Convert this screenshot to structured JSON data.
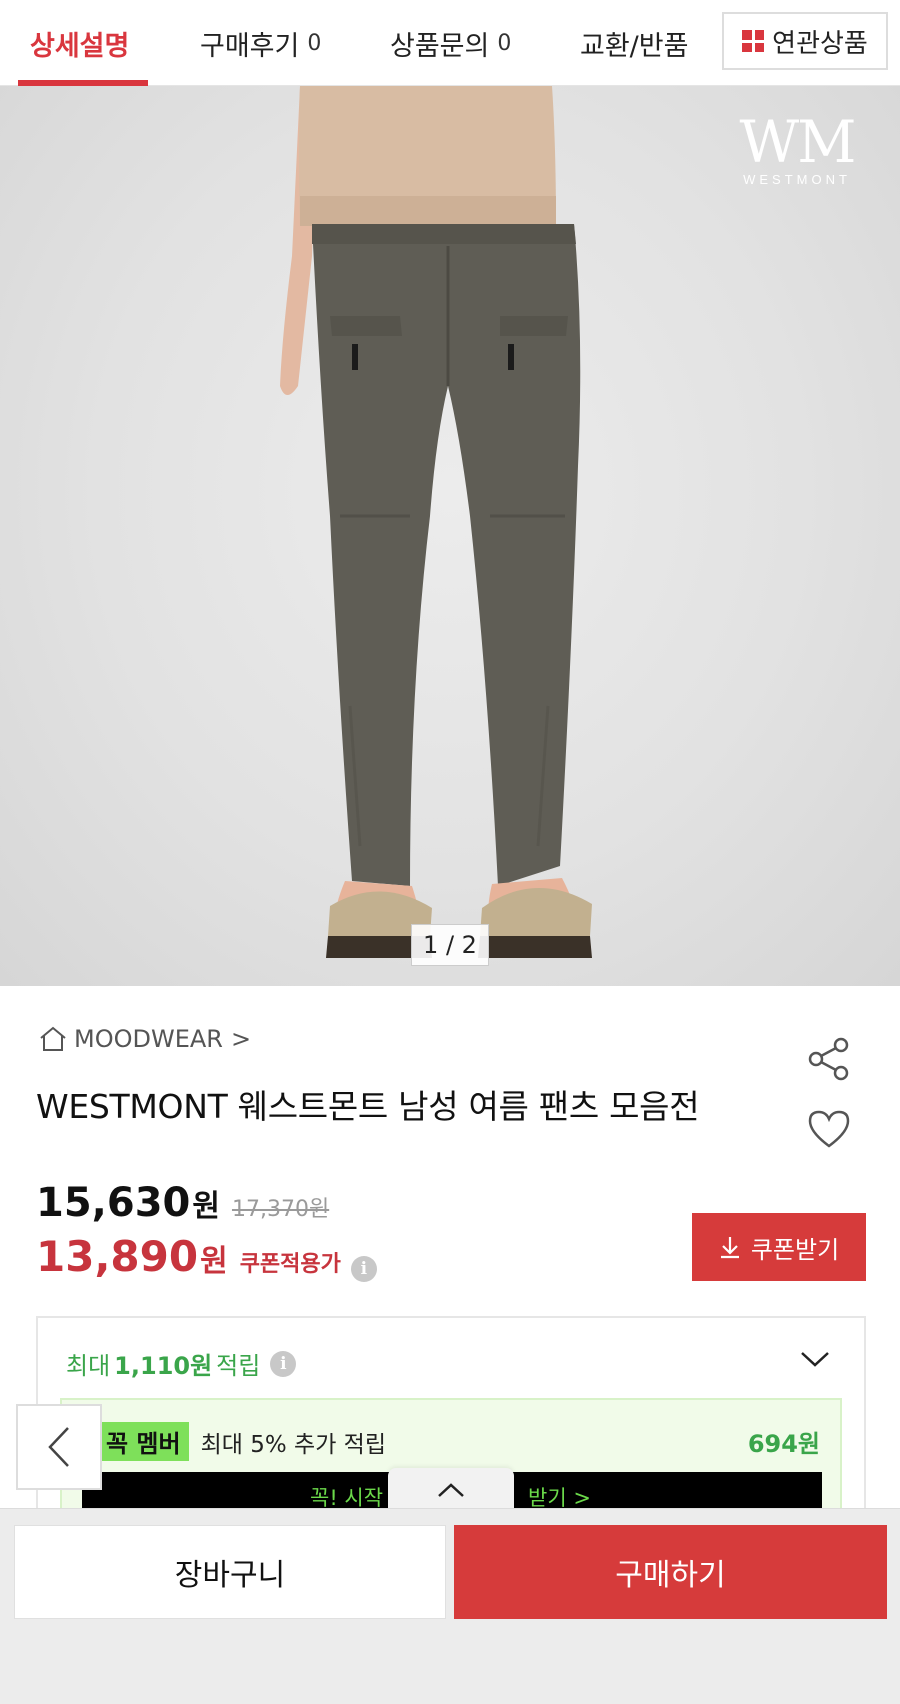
{
  "tabs": [
    {
      "label": "상세설명",
      "count": "",
      "active": true
    },
    {
      "label": "구매후기",
      "count": "0",
      "active": false
    },
    {
      "label": "상품문의",
      "count": "0",
      "active": false
    },
    {
      "label": "교환/반품",
      "count": "",
      "active": false
    }
  ],
  "related_button": {
    "label": "연관상품",
    "icon": "grid-icon"
  },
  "hero": {
    "logo_letters": "WM",
    "logo_word": "WESTMONT",
    "pager": "1 / 2"
  },
  "product": {
    "brand": "MOODWEAR",
    "brand_chevron": ">",
    "title": "WESTMONT 웨스트몬트 남성 여름 팬츠 모음전",
    "share_icon": "share-icon",
    "wishlist_icon": "heart-icon"
  },
  "price": {
    "sale": "15,630",
    "sale_unit": "원",
    "original": "17,370원",
    "coupon_price": "13,890",
    "coupon_unit": "원",
    "coupon_label": "쿠폰적용가",
    "info_glyph": "i"
  },
  "coupon_button": {
    "label": "쿠폰받기",
    "icon": "download-icon"
  },
  "points": {
    "prefix": "최대",
    "amount": "1,110원",
    "suffix": "적립",
    "info_glyph": "i"
  },
  "member": {
    "badge": "꼭 멤버",
    "text": "최대 5% 추가 적립",
    "amount": "694원",
    "banner_left": "꼭! 시작",
    "banner_right": "받기 >"
  },
  "colors": {
    "accent_red": "#d9363e",
    "button_red": "#d63b3b",
    "point_green": "#3aa54a",
    "member_green": "#7ee05a"
  },
  "bottom": {
    "cart_label": "장바구니",
    "buy_label": "구매하기"
  }
}
